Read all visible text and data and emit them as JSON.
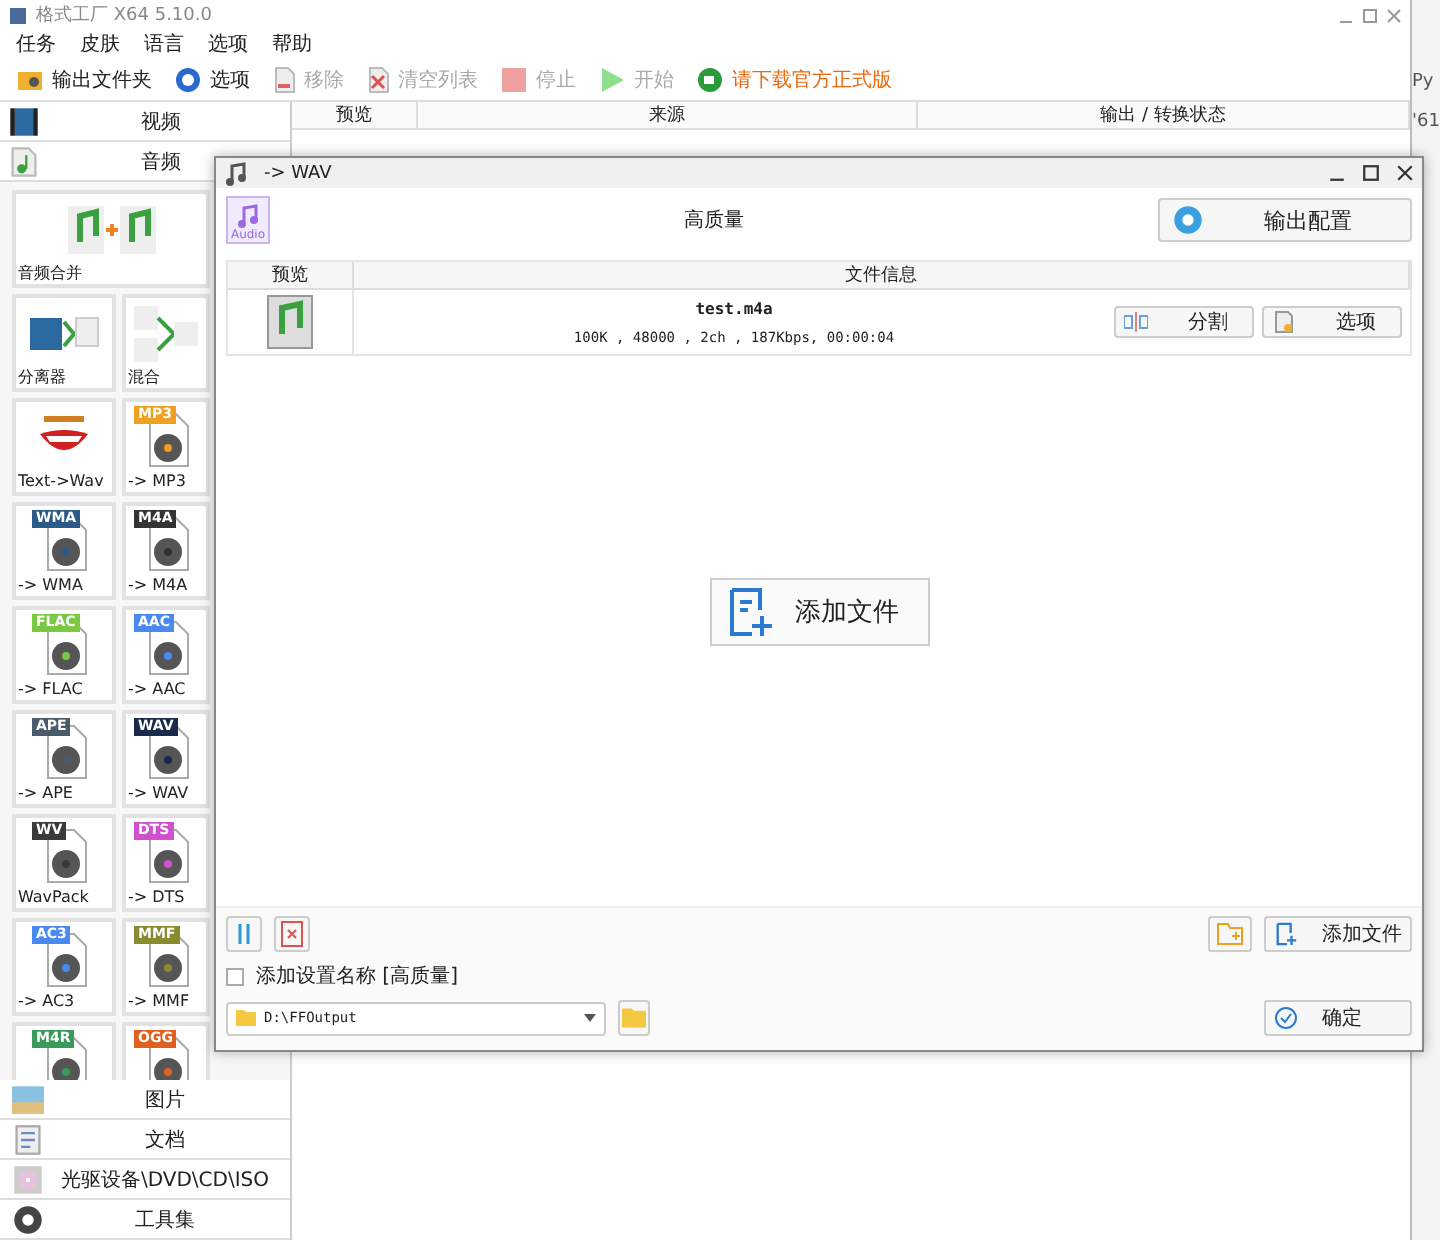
{
  "window": {
    "title": "格式工厂 X64 5.10.0"
  },
  "menu": [
    "任务",
    "皮肤",
    "语言",
    "选项",
    "帮助"
  ],
  "toolbar": [
    {
      "label": "输出文件夹",
      "kind": "folder",
      "disabled": false
    },
    {
      "label": "选项",
      "kind": "options",
      "disabled": false
    },
    {
      "label": "移除",
      "kind": "remove",
      "disabled": true
    },
    {
      "label": "清空列表",
      "kind": "clear",
      "disabled": true
    },
    {
      "label": "停止",
      "kind": "stop",
      "disabled": true
    },
    {
      "label": "开始",
      "kind": "start",
      "disabled": true
    },
    {
      "label": "请下载官方正式版",
      "kind": "download",
      "disabled": false
    }
  ],
  "sidebar": {
    "categories_top": [
      {
        "label": "视频",
        "kind": "video"
      },
      {
        "label": "音频",
        "kind": "audio"
      }
    ],
    "tiles": [
      {
        "label": "音频合并",
        "kind": "merge"
      },
      {
        "label": "分离器",
        "kind": "split"
      },
      {
        "label": "混合",
        "kind": "mix"
      },
      {
        "label": "Text->Wav",
        "kind": "tts"
      },
      {
        "label": "-> MP3",
        "kind": "format",
        "tag": "MP3",
        "color": "#f0a020"
      },
      {
        "label": "-> WMA",
        "kind": "format",
        "tag": "WMA",
        "color": "#2a5a8a"
      },
      {
        "label": "-> M4A",
        "kind": "format",
        "tag": "M4A",
        "color": "#333333"
      },
      {
        "label": "-> FLAC",
        "kind": "format",
        "tag": "FLAC",
        "color": "#7ac943"
      },
      {
        "label": "-> AAC",
        "kind": "format",
        "tag": "AAC",
        "color": "#4a8af0"
      },
      {
        "label": "-> APE",
        "kind": "format",
        "tag": "APE",
        "color": "#4a5a6a"
      },
      {
        "label": "-> WAV",
        "kind": "format",
        "tag": "WAV",
        "color": "#1a2a4a"
      },
      {
        "label": "WavPack",
        "kind": "format",
        "tag": "WV",
        "color": "#3a3a3a"
      },
      {
        "label": "-> DTS",
        "kind": "format",
        "tag": "DTS",
        "color": "#d050d0"
      },
      {
        "label": "-> AC3",
        "kind": "format",
        "tag": "AC3",
        "color": "#4a8af0"
      },
      {
        "label": "-> MMF",
        "kind": "format",
        "tag": "MMF",
        "color": "#8a8a30"
      },
      {
        "kind": "format",
        "tag": "M4R",
        "color": "#3a9a5a"
      },
      {
        "kind": "format",
        "tag": "OGG",
        "color": "#e06020"
      }
    ],
    "categories_bottom": [
      {
        "label": "图片",
        "kind": "picture"
      },
      {
        "label": "文档",
        "kind": "document"
      },
      {
        "label": "光驱设备\\DVD\\CD\\ISO",
        "kind": "disc"
      },
      {
        "label": "工具集",
        "kind": "tools"
      }
    ]
  },
  "table": {
    "columns": [
      "预览",
      "来源",
      "输出 / 转换状态"
    ]
  },
  "background_window": {
    "texts": [
      "Py",
      "'61"
    ]
  },
  "dialog": {
    "title": "-> WAV",
    "audio_badge": "Audio",
    "preset": "高质量",
    "config_button": "输出配置",
    "columns": [
      "预览",
      "文件信息"
    ],
    "files": [
      {
        "name": "test.m4a",
        "info": "100K , 48000 , 2ch , 187Kbps, 00:00:04",
        "buttons": [
          "分割",
          "选项"
        ]
      }
    ],
    "add_file_center": "添加文件",
    "add_file_button": "添加文件",
    "save_name": {
      "label": "添加设置名称 [高质量]",
      "checked": false
    },
    "output_path": "D:\\FFOutput",
    "ok_button": "确定"
  }
}
